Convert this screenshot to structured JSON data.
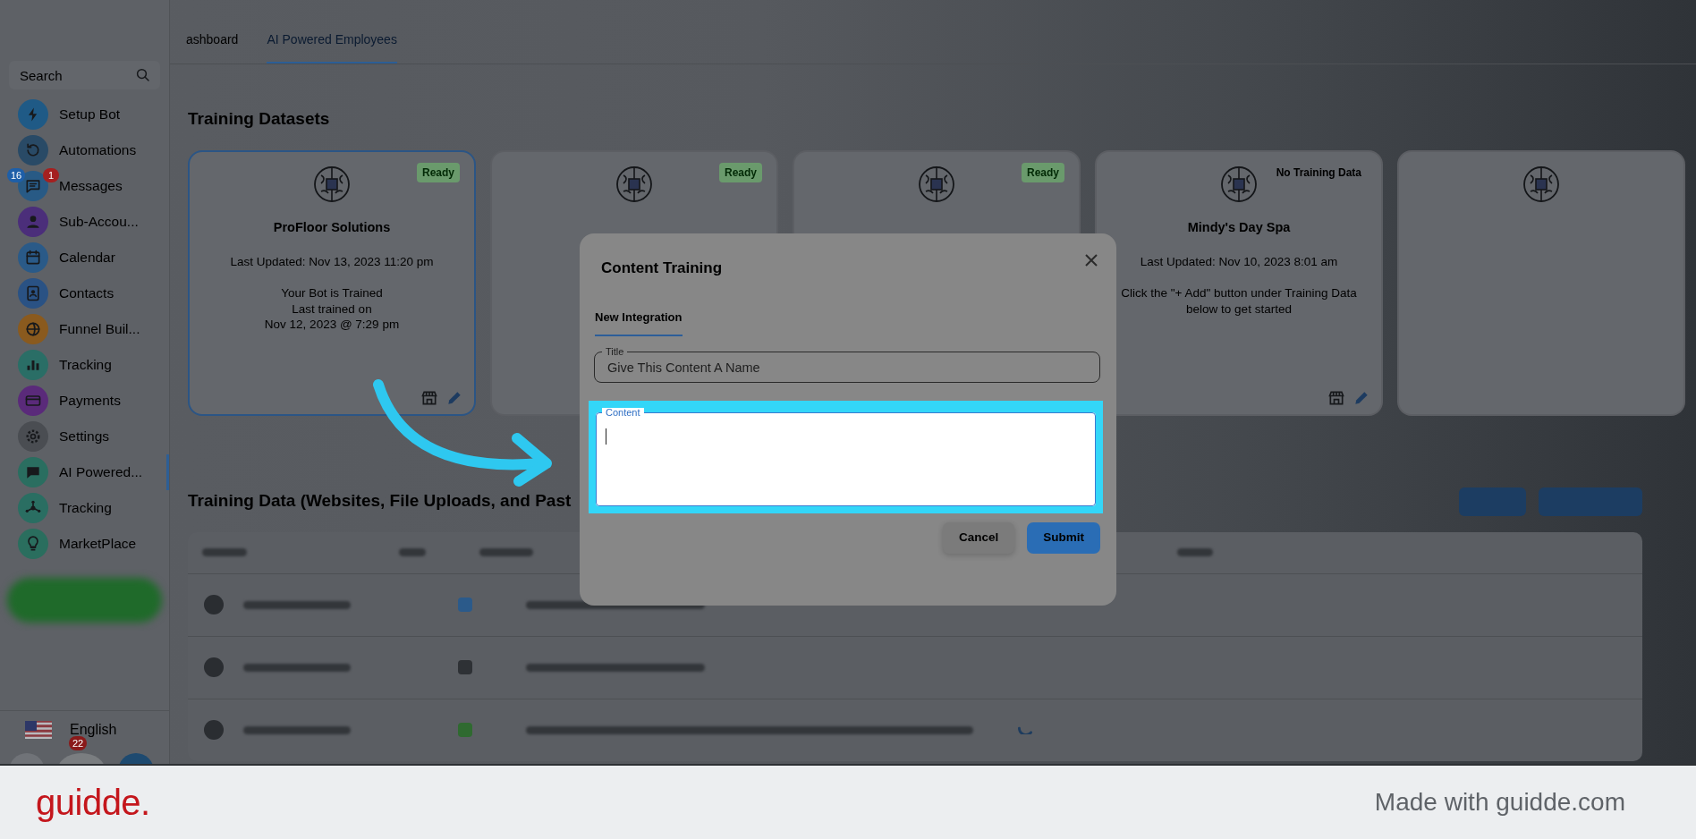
{
  "sidebar": {
    "search": {
      "placeholder": "Search"
    },
    "items": [
      {
        "label": "Setup Bot",
        "color": "#1f5a86",
        "selected": false
      },
      {
        "label": "Automations",
        "color": "#294a66",
        "selected": false
      },
      {
        "label": "Messages",
        "color": "#285a85",
        "selected": false,
        "badges": [
          {
            "text": "16",
            "color": "#1e5fa8"
          },
          {
            "text": "1",
            "color": "#a52020"
          }
        ]
      },
      {
        "label": "Sub-Accou...",
        "color": "#4b2e7a",
        "selected": false
      },
      {
        "label": "Calendar",
        "color": "#2a5a88",
        "selected": false
      },
      {
        "label": "Contacts",
        "color": "#2a5284",
        "selected": false
      },
      {
        "label": "Funnel Buil...",
        "color": "#8a5a1e",
        "selected": false
      },
      {
        "label": "Tracking",
        "color": "#2a6e66",
        "selected": false
      },
      {
        "label": "Payments",
        "color": "#5a2a7a",
        "selected": false
      },
      {
        "label": "Settings",
        "color": "#4a4d52",
        "selected": false
      },
      {
        "label": "AI Powered...",
        "color": "#2a6e60",
        "selected": true
      },
      {
        "label": "Tracking",
        "color": "#2a6e62",
        "selected": false
      },
      {
        "label": "MarketPlace",
        "color": "#2a6e5e",
        "selected": false
      }
    ],
    "language": "English",
    "notification_count": "22"
  },
  "top_tabs": [
    {
      "label": "ashboard",
      "selected": false
    },
    {
      "label": "AI Powered Employees",
      "selected": true
    }
  ],
  "datasets": {
    "title": "Training Datasets",
    "cards": [
      {
        "name": "ProFloor Solutions",
        "lines": [
          "Last Updated: Nov 13, 2023 11:20 pm",
          "Your Bot is Trained\nLast trained on\nNov 12, 2023 @ 7:29 pm"
        ],
        "status": {
          "text": "Ready",
          "kind": "ready"
        },
        "selected": true,
        "show_actions": true
      },
      {
        "status": {
          "text": "Ready",
          "kind": "ready"
        },
        "selected": false,
        "show_actions": false
      },
      {
        "status": {
          "text": "Ready",
          "kind": "ready"
        },
        "selected": false,
        "show_actions": false
      },
      {
        "name": "Mindy's Day Spa",
        "lines": [
          "Last Updated: Nov 10, 2023 8:01 am",
          "Click the \"+ Add\" button under Training Data\nbelow to get started"
        ],
        "status": {
          "text": "No Training Data",
          "kind": "empty"
        },
        "selected": false,
        "show_actions": true
      },
      {
        "selected": false,
        "show_actions": false
      }
    ]
  },
  "training_data": {
    "title": "Training Data (Websites, File Uploads, and Past",
    "rows": [
      {
        "color": "#2b5a8a"
      },
      {
        "color": "#2e3135"
      },
      {
        "color": "#2f6a30"
      }
    ]
  },
  "modal": {
    "title": "Content Training",
    "tabs": [
      {
        "label": "New Integration",
        "selected": true
      }
    ],
    "title_field": {
      "label": "Title",
      "placeholder": "Give This Content A Name"
    },
    "content_field": {
      "label": "Content",
      "highlighted": true
    },
    "buttons": [
      {
        "label": "Cancel",
        "kind": "secondary"
      },
      {
        "label": "Submit",
        "kind": "primary"
      }
    ]
  },
  "footer": {
    "logo": "guidde.",
    "credit": "Made with guidde.com"
  }
}
